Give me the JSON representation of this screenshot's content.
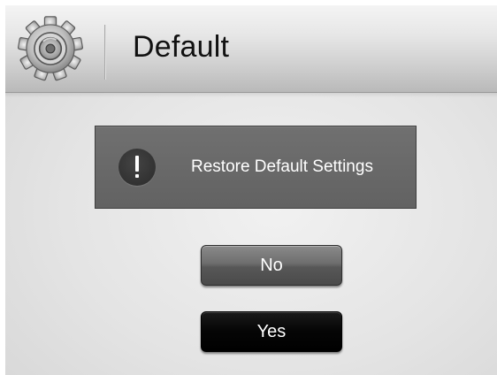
{
  "header": {
    "title": "Default",
    "icon": "gear-icon"
  },
  "dialog": {
    "message": "Restore Default Settings",
    "icon": "alert-icon"
  },
  "buttons": {
    "no_label": "No",
    "yes_label": "Yes"
  },
  "colors": {
    "message_box": "#666666",
    "no_button": "#6a6a6a",
    "yes_button": "#000000",
    "text_light": "#ffffff",
    "title_text": "#111111"
  }
}
